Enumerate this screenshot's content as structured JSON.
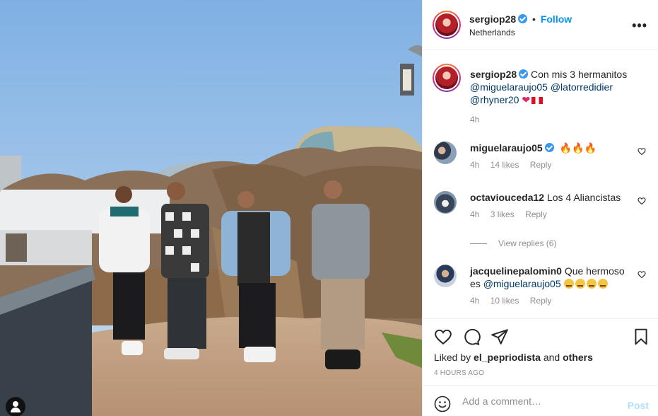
{
  "post": {
    "author": "sergiop28",
    "follow_label": "Follow",
    "dot": "•",
    "location": "Netherlands",
    "more_icon": "more-horizontal-icon",
    "caption": {
      "text": "Con mis 3 hermanitos",
      "mentions": [
        "@miguelaraujo05",
        "@latorredidier",
        "@rhyner20"
      ],
      "emojis": [
        "heart-emoji",
        "peru-flag-emoji"
      ],
      "time": "4h"
    }
  },
  "comments": [
    {
      "user": "miguelaraujo05",
      "verified": true,
      "text": "",
      "emojis": [
        "fire-emoji",
        "fire-emoji",
        "fire-emoji"
      ],
      "time": "4h",
      "likes": "14 likes",
      "reply": "Reply"
    },
    {
      "user": "octaviouceda12",
      "verified": false,
      "text": "Los 4 Aliancistas",
      "time": "4h",
      "likes": "3 likes",
      "reply": "Reply"
    },
    {
      "user": "jacquelinepalomin0",
      "verified": false,
      "text": "Que hermoso es",
      "mention": "@miguelaraujo05",
      "emojis": [
        "expressionless-face-emoji",
        "expressionless-face-emoji",
        "expressionless-face-emoji",
        "expressionless-face-emoji"
      ],
      "time": "4h",
      "likes": "10 likes",
      "reply": "Reply"
    }
  ],
  "view_replies": "View replies (6)",
  "actions": {
    "icons": [
      "heart-icon",
      "comment-icon",
      "share-icon",
      "bookmark-icon"
    ],
    "liked_by_prefix": "Liked by",
    "liked_by_user": "el_pepriodista",
    "liked_by_and": "and",
    "liked_by_others": "others",
    "time_ago": "4 HOURS AGO"
  },
  "add_comment": {
    "placeholder": "Add a comment…",
    "post_label": "Post"
  },
  "colors": {
    "accent": "#0095f6",
    "post_disabled": "#b2dffc",
    "muted": "#8e8e8e",
    "mention": "#00376b",
    "sky": "#9cc3ea"
  }
}
